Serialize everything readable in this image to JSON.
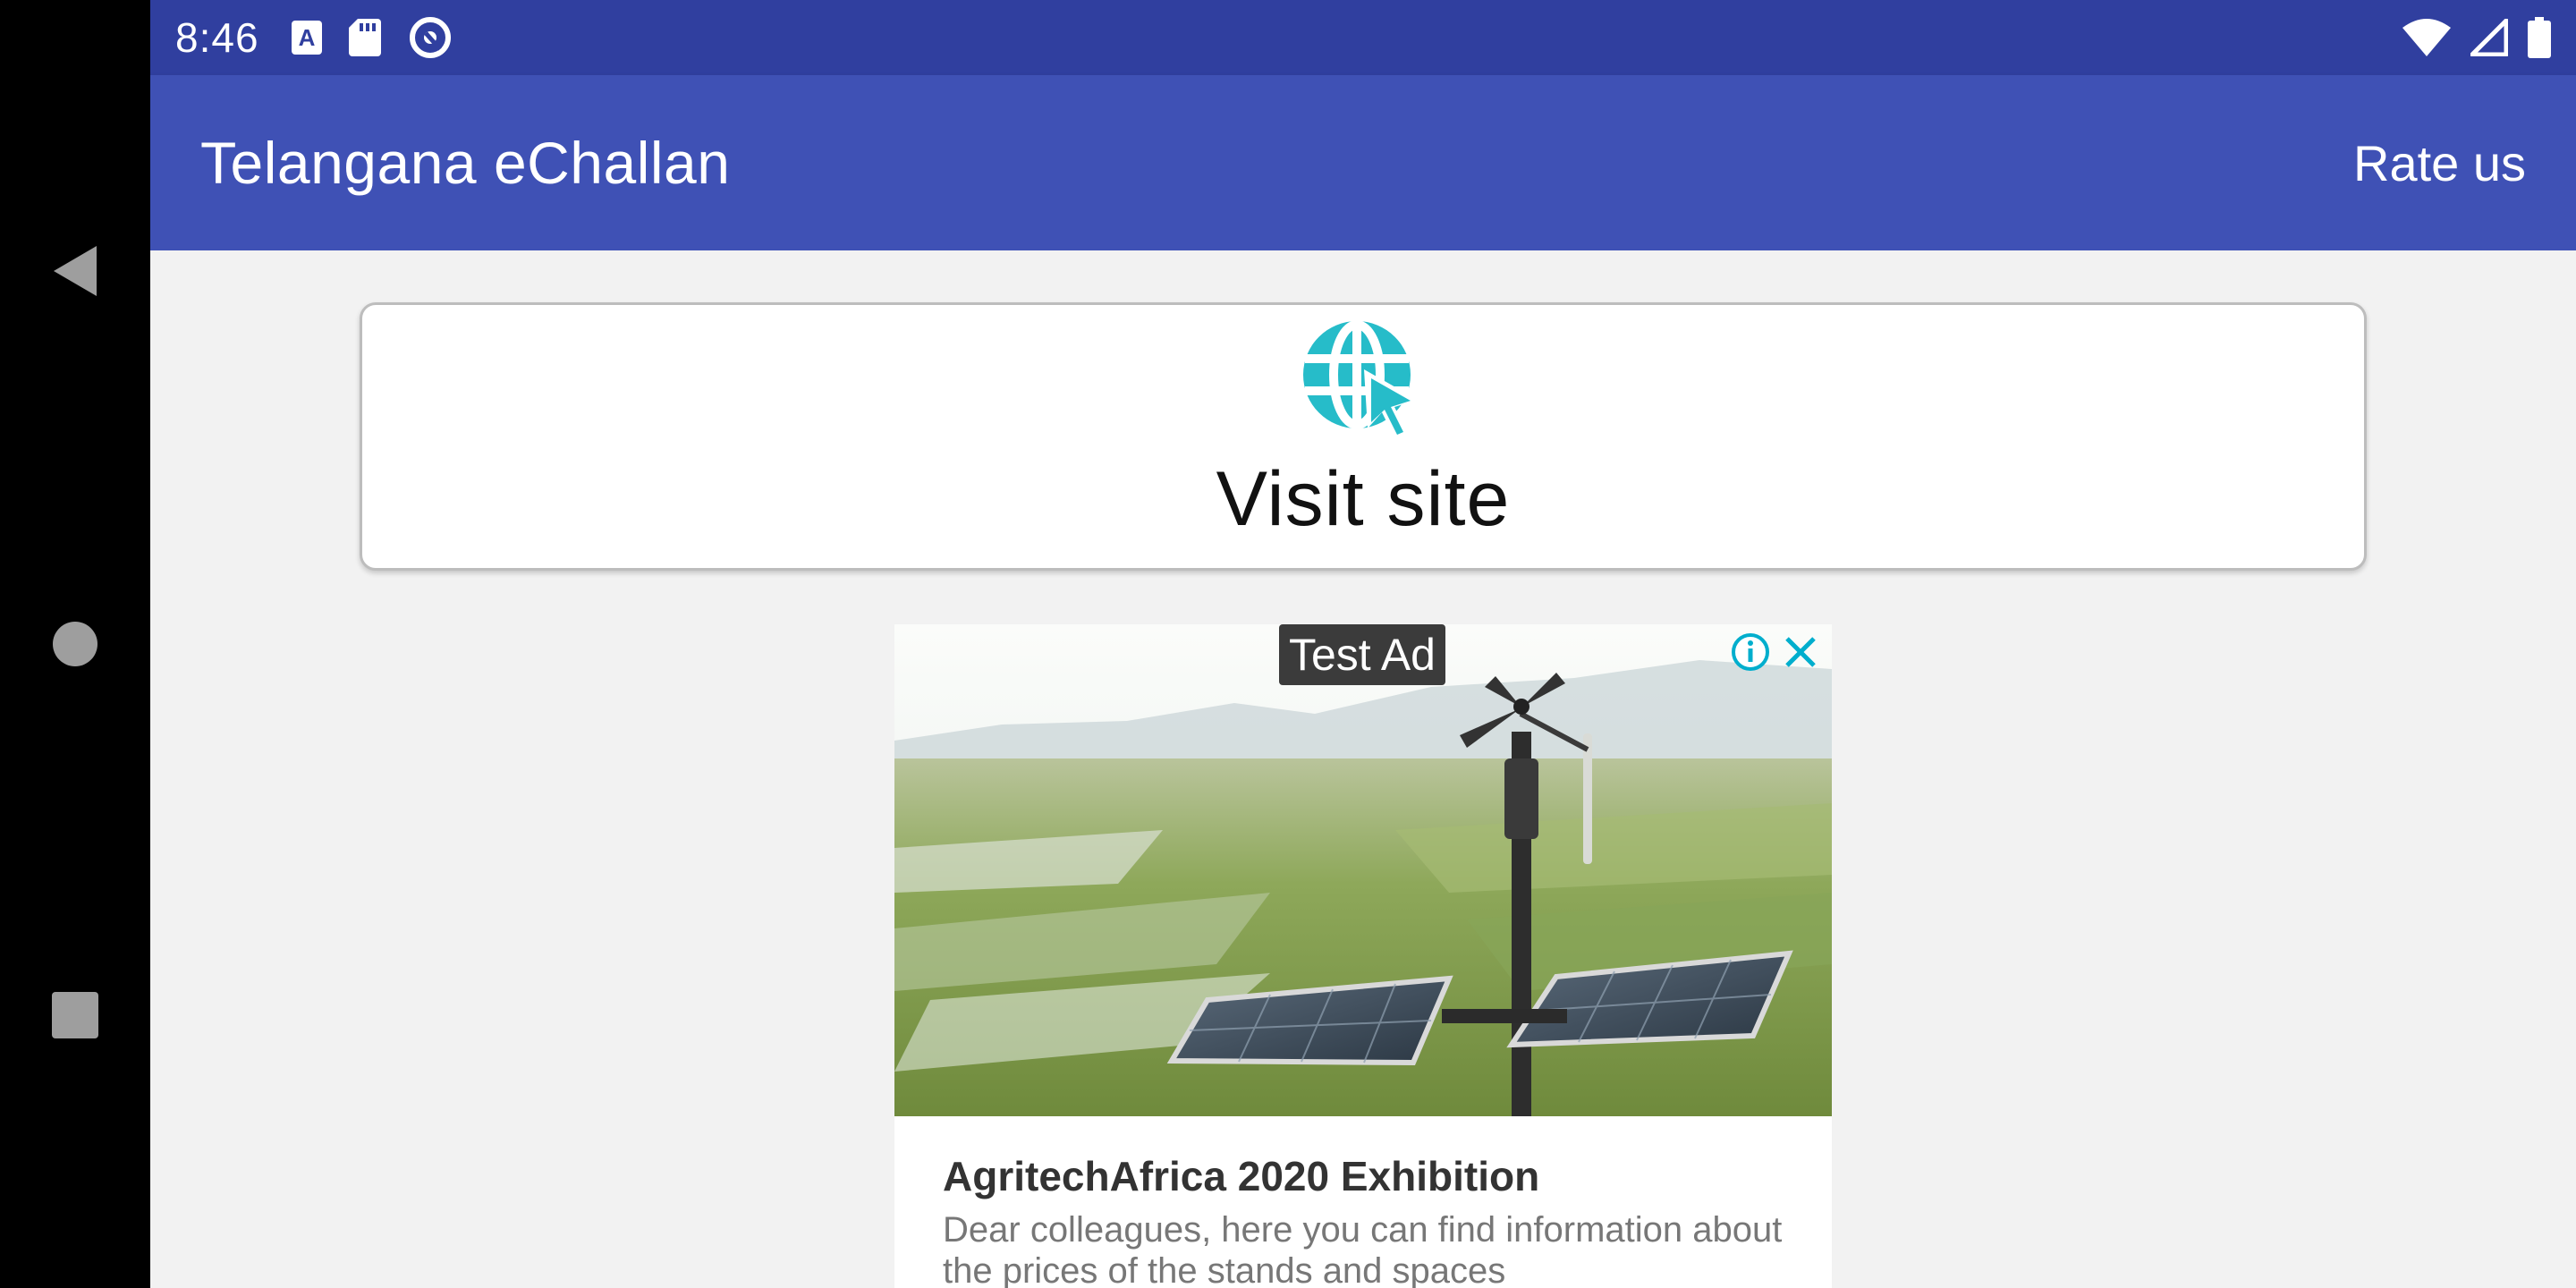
{
  "status_bar": {
    "time": "8:46",
    "left_icons": [
      "font-a-icon",
      "sd-card-icon",
      "sync-circle-icon"
    ],
    "right_icons": [
      "wifi-icon",
      "cell-signal-icon",
      "battery-icon"
    ]
  },
  "navigation": {
    "back": "back-icon",
    "home": "home-icon",
    "recents": "recents-icon"
  },
  "app_bar": {
    "title": "Telangana eChallan",
    "action": "Rate us"
  },
  "visit_card": {
    "icon": "globe-cursor-icon",
    "label": "Visit site"
  },
  "ad": {
    "badge": "Test Ad",
    "title": "AgritechAfrica 2020 Exhibition",
    "description": "Dear colleagues, here you can find information about the prices of the stands and spaces"
  },
  "colors": {
    "status_bar": "#303f9f",
    "app_bar": "#3f51b5",
    "background": "#f2f2f2",
    "icon_accent": "#26bcc9",
    "ad_accent": "#00aecd"
  }
}
